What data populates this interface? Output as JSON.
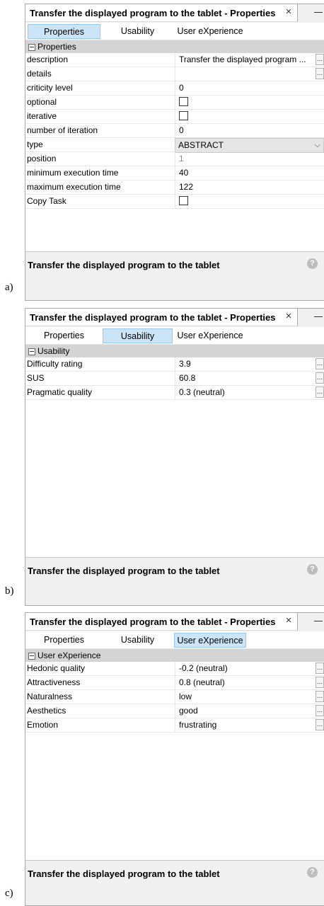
{
  "labels": {
    "a": "a)",
    "b": "b)",
    "c": "c)"
  },
  "icons": {
    "close": "close-icon",
    "minimize": "minimize-icon",
    "help": "help-icon",
    "ellipsis": "ellipsis-button",
    "collapse": "collapse-icon",
    "dropdown": "chevron-down-icon"
  },
  "colors": {
    "active_tab": "#cce4f7",
    "section_header": "#d4d4d4",
    "panel_bg": "#f0f0f0"
  },
  "panel_a": {
    "title": "Transfer the displayed program to the tablet - Properties",
    "close": "×",
    "tabs": [
      "Properties",
      "Usability",
      "User eXperience"
    ],
    "active_tab": "Properties",
    "section": "Properties",
    "rows": [
      {
        "name": "description",
        "value": "Transfer the displayed program ...",
        "ellipsis": "..."
      },
      {
        "name": "details",
        "value": "",
        "ellipsis": "..."
      },
      {
        "name": "criticity level",
        "value": "0"
      },
      {
        "name": "optional",
        "checkbox": false
      },
      {
        "name": "iterative",
        "checkbox": false
      },
      {
        "name": "number of iteration",
        "value": "0"
      },
      {
        "name": "type",
        "value": "ABSTRACT",
        "dropdown": "⌵"
      },
      {
        "name": "position",
        "value": "1"
      },
      {
        "name": "minimum execution time",
        "value": "40"
      },
      {
        "name": "maximum execution time",
        "value": "122"
      },
      {
        "name": "Copy Task",
        "checkbox": false
      }
    ],
    "description": "Transfer the displayed program to the tablet",
    "help": "?"
  },
  "panel_b": {
    "title": "Transfer the displayed program to the tablet - Properties",
    "close": "×",
    "tabs": [
      "Properties",
      "Usability",
      "User eXperience"
    ],
    "active_tab": "Usability",
    "section": "Usability",
    "rows": [
      {
        "name": "Difficulty rating",
        "value": "3.9",
        "ellipsis": "..."
      },
      {
        "name": "SUS",
        "value": "60.8",
        "ellipsis": "..."
      },
      {
        "name": "Pragmatic quality",
        "value": "0.3 (neutral)",
        "ellipsis": "..."
      }
    ],
    "description": "Transfer the displayed program to the tablet",
    "help": "?"
  },
  "panel_c": {
    "title": "Transfer the displayed program to the tablet - Properties",
    "close": "×",
    "tabs": [
      "Properties",
      "Usability",
      "User eXperience"
    ],
    "active_tab": "User eXperience",
    "section": "User eXperience",
    "rows": [
      {
        "name": "Hedonic quality",
        "value": "-0.2 (neutral)",
        "ellipsis": "..."
      },
      {
        "name": "Attractiveness",
        "value": "0.8 (neutral)",
        "ellipsis": "..."
      },
      {
        "name": "Naturalness",
        "value": "low",
        "ellipsis": "..."
      },
      {
        "name": "Aesthetics",
        "value": "good",
        "ellipsis": "..."
      },
      {
        "name": "Emotion",
        "value": "frustrating",
        "ellipsis": "..."
      }
    ],
    "description": "Transfer the displayed program to the tablet",
    "help": "?"
  }
}
